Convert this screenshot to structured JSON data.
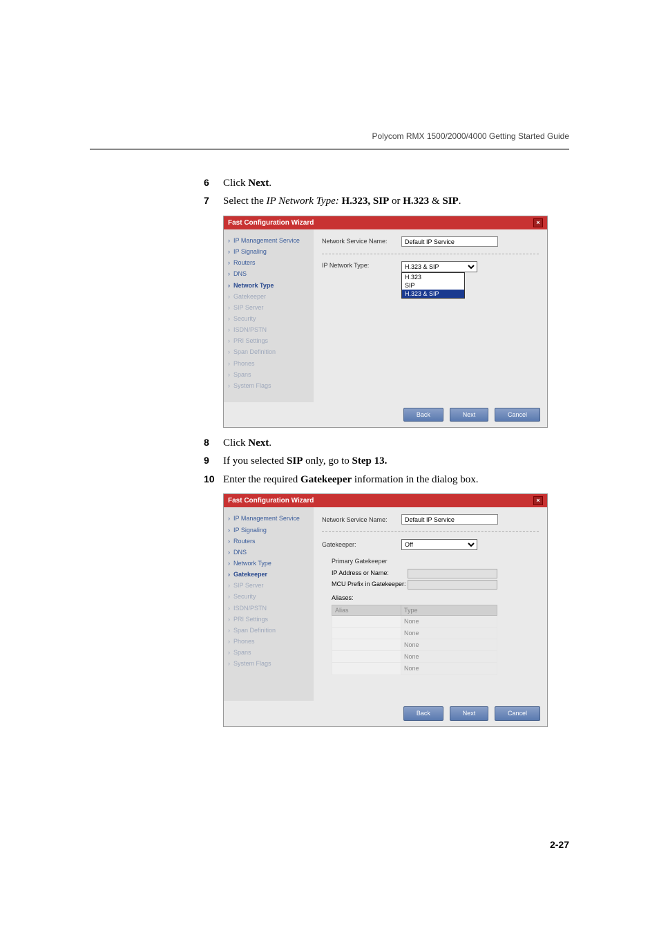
{
  "header": {
    "title": "Polycom RMX 1500/2000/4000 Getting Started Guide"
  },
  "steps": {
    "s6": {
      "num": "6",
      "pre": "Click ",
      "bold": "Next",
      "post": "."
    },
    "s7": {
      "num": "7",
      "pre": "Select the ",
      "italic": "IP Network Type: ",
      "bold1": "H.323, SIP",
      "mid": " or ",
      "bold2": "H.323",
      "amp": " & ",
      "bold3": "SIP",
      "post": "."
    },
    "s8": {
      "num": "8",
      "pre": "Click ",
      "bold": "Next",
      "post": "."
    },
    "s9": {
      "num": "9",
      "pre": "If you selected ",
      "bold1": "SIP",
      "mid": " only, go to ",
      "bold2": "Step 13."
    },
    "s10": {
      "num": "10",
      "pre": "Enter the required ",
      "bold": "Gatekeeper",
      "post": " information in the dialog box."
    }
  },
  "wizard_labels": {
    "title": "Fast Configuration Wizard",
    "nsn_label": "Network Service Name:",
    "nsn_value": "Default IP Service",
    "ipnt_label": "IP Network Type:",
    "back": "Back",
    "next": "Next",
    "cancel": "Cancel"
  },
  "chart_data": [
    {
      "type": "table",
      "title": "Fast Configuration Wizard — Network Type",
      "sidebar": [
        "IP Management Service",
        "IP Signaling",
        "Routers",
        "DNS",
        "Network Type",
        "Gatekeeper",
        "SIP Server",
        "Security",
        "ISDN/PSTN",
        "PRI Settings",
        "Span Definition",
        "Phones",
        "Spans",
        "System Flags"
      ],
      "sidebar_state": [
        "done",
        "done",
        "done",
        "done",
        "current",
        "disabled",
        "disabled",
        "disabled",
        "disabled",
        "disabled",
        "disabled",
        "disabled",
        "disabled",
        "disabled"
      ],
      "fields": [
        {
          "label": "Network Service Name:",
          "value": "Default IP Service"
        },
        {
          "label": "IP Network Type:",
          "selected": "H.323 & SIP",
          "options": [
            "H.323",
            "SIP",
            "H.323 & SIP"
          ]
        }
      ],
      "buttons": [
        "Back",
        "Next",
        "Cancel"
      ]
    },
    {
      "type": "table",
      "title": "Fast Configuration Wizard — Gatekeeper",
      "sidebar": [
        "IP Management Service",
        "IP Signaling",
        "Routers",
        "DNS",
        "Network Type",
        "Gatekeeper",
        "SIP Server",
        "Security",
        "ISDN/PSTN",
        "PRI Settings",
        "Span Definition",
        "Phones",
        "Spans",
        "System Flags"
      ],
      "sidebar_state": [
        "done",
        "done",
        "done",
        "done",
        "done",
        "current",
        "disabled",
        "disabled",
        "disabled",
        "disabled",
        "disabled",
        "disabled",
        "disabled",
        "disabled"
      ],
      "fields": [
        {
          "label": "Network Service Name:",
          "value": "Default IP Service"
        },
        {
          "label": "Gatekeeper:",
          "selected": "Off"
        },
        {
          "label": "Primary Gatekeeper",
          "value": ""
        },
        {
          "label": "IP Address or Name:",
          "value": ""
        },
        {
          "label": "MCU Prefix in Gatekeeper:",
          "value": ""
        },
        {
          "label": "Aliases:",
          "columns": [
            "Alias",
            "Type"
          ],
          "rows": [
            [
              "",
              "None"
            ],
            [
              "",
              "None"
            ],
            [
              "",
              "None"
            ],
            [
              "",
              "None"
            ],
            [
              "",
              "None"
            ]
          ]
        }
      ],
      "buttons": [
        "Back",
        "Next",
        "Cancel"
      ]
    }
  ],
  "nav": {
    "items": [
      "IP Management Service",
      "IP Signaling",
      "Routers",
      "DNS",
      "Network Type",
      "Gatekeeper",
      "SIP Server",
      "Security",
      "ISDN/PSTN",
      "PRI Settings",
      "Span Definition",
      "Phones",
      "Spans",
      "System Flags"
    ]
  },
  "gk": {
    "label": "Gatekeeper:",
    "value": "Off",
    "primary": "Primary Gatekeeper",
    "ipaddr": "IP Address or Name:",
    "prefix": "MCU Prefix in Gatekeeper:",
    "aliases": "Aliases:",
    "col1": "Alias",
    "col2": "Type",
    "none": "None"
  },
  "ipnt": {
    "selected": "H.323 & SIP",
    "o1": "H.323",
    "o2": "SIP",
    "o3": "H.323 & SIP"
  },
  "page_num": "2-27"
}
